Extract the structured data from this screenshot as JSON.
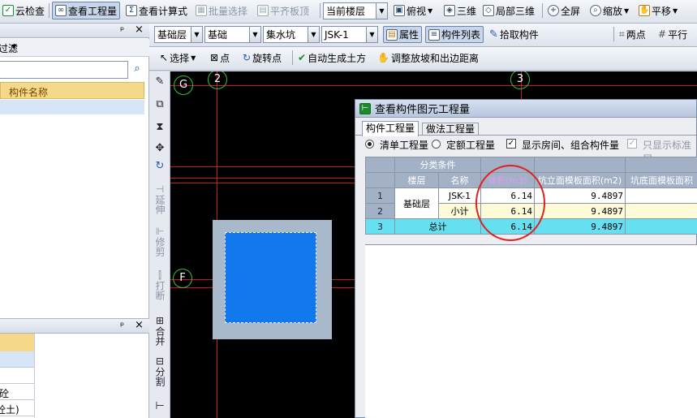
{
  "toolbar1": {
    "cloud_check": "云检查",
    "view_quantity": "查看工程量",
    "view_formula": "查看计算式",
    "batch_select": "批量选择",
    "flush_slab": "平齐板顶",
    "floor_select": "当前楼层",
    "top_view": "俯视",
    "three_d": "三维",
    "local_3d": "局部三维",
    "fullscreen": "全屏",
    "zoom": "缩放",
    "pan": "平移"
  },
  "toolbar2": {
    "floor": "基础层",
    "category": "基础",
    "type": "集水坑",
    "component": "JSK-1",
    "properties": "属性",
    "component_list": "构件列表",
    "pick_component": "拾取构件",
    "two_point": "两点",
    "parallel": "平行"
  },
  "toolbar3": {
    "select": "选择",
    "point": "点",
    "rotate_point": "旋转点",
    "auto_earthwork": "自动生成土方",
    "adjust_slope": "调整放坡和出边距离"
  },
  "left_panel": {
    "pin": "ᵖ",
    "close": "×",
    "filter": "过滤",
    "column_name": "构件名称",
    "bottom_rows": [
      "砼",
      "砼土)"
    ]
  },
  "vertical_tools": {
    "extend": "延伸",
    "trim": "修剪",
    "break": "打断",
    "merge": "合并",
    "split": "分割"
  },
  "axes": {
    "g": "G",
    "f": "F",
    "two": "2",
    "three": "3"
  },
  "dialog": {
    "title": "查看构件图元工程量",
    "tabs": [
      "构件工程量",
      "做法工程量"
    ],
    "radio_list": "清单工程量",
    "radio_quota": "定额工程量",
    "show_rooms": "显示房间、组合构件量",
    "show_standard": "只显示标准层",
    "header_group": "分类条件",
    "col_floor": "楼层",
    "col_name": "名称",
    "col_volume": "体积(m3)",
    "col_side_form": "坑立面模板面积(m2)",
    "col_bottom_form": "坑底面模板面积",
    "rows": [
      {
        "no": "1",
        "name": "JSK-1",
        "volume": "6.14",
        "side": "9.4897"
      },
      {
        "no": "2",
        "name": "小计",
        "volume": "6.14",
        "side": "9.4897"
      },
      {
        "no": "3",
        "name": "总计",
        "volume": "6.14",
        "side": "9.4897"
      }
    ],
    "floor_value": "基础层"
  },
  "colors": {
    "pit_fill": "#1278ee",
    "pit_border": "#a9b9cc",
    "highlight_circle": "#e02020",
    "total_row": "#66dff0"
  }
}
